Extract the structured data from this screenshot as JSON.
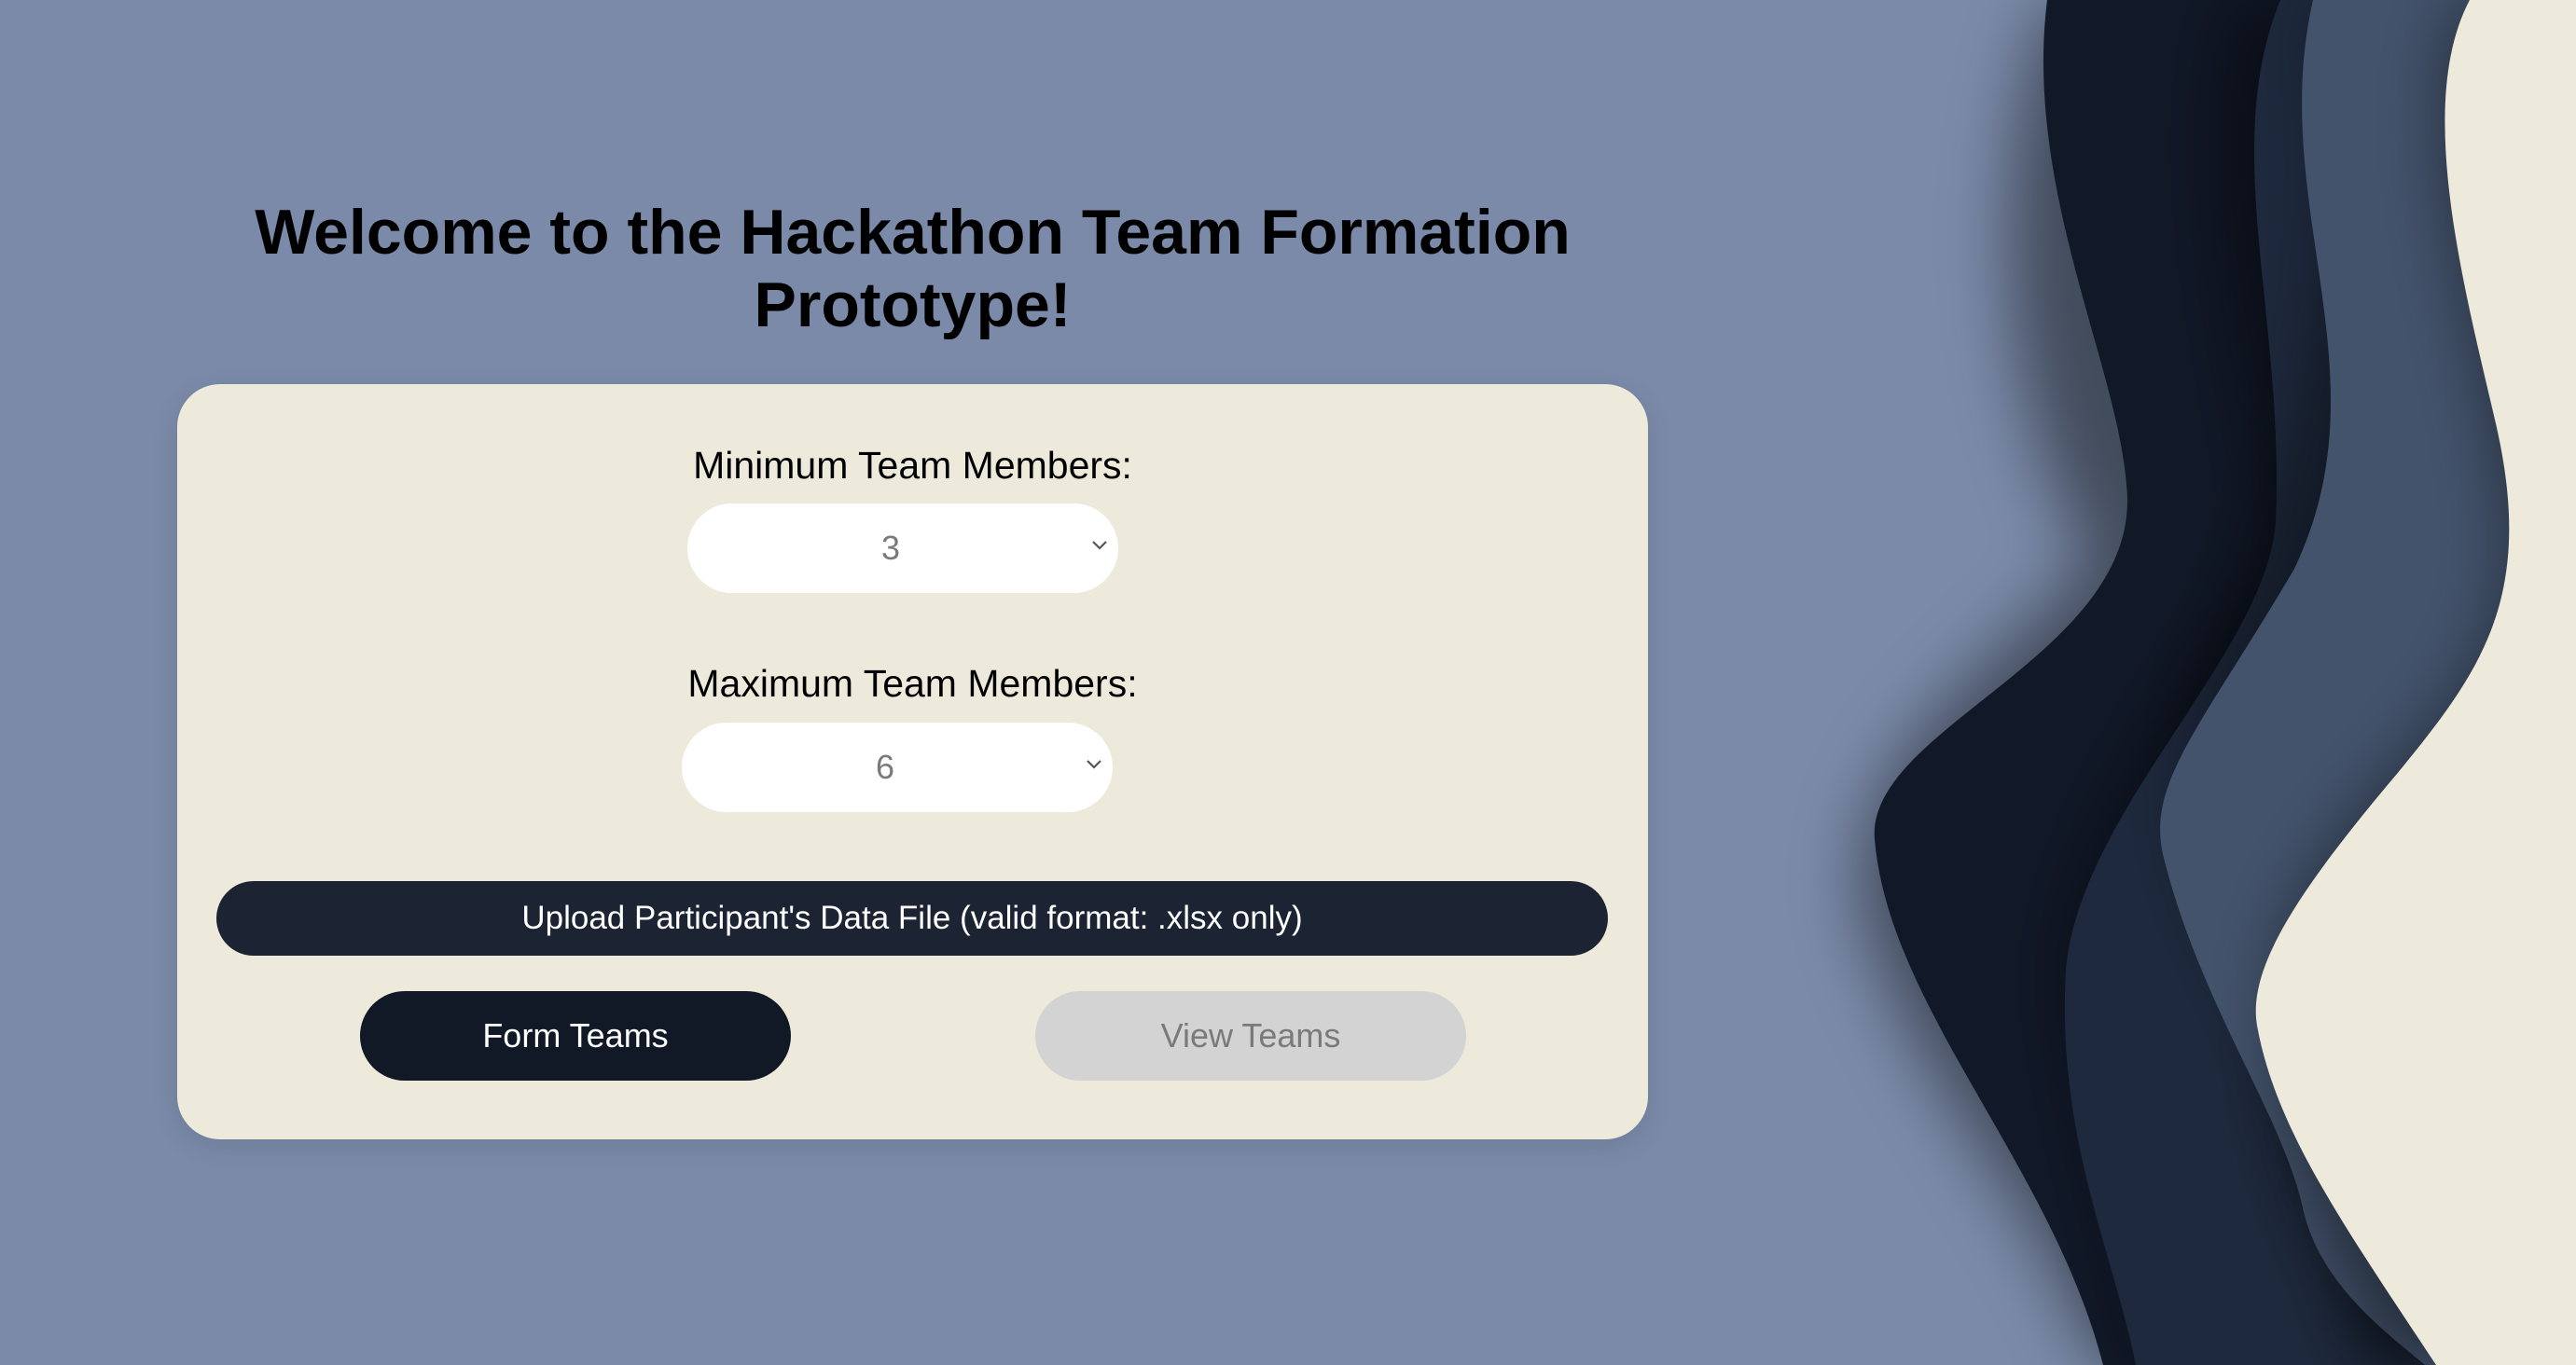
{
  "page": {
    "title": "Welcome to the Hackathon Team Formation Prototype!"
  },
  "form": {
    "min_label": "Minimum Team Members:",
    "min_value": "3",
    "max_label": "Maximum Team Members:",
    "max_value": "6",
    "upload_label": "Upload Participant's Data File (valid format: .xlsx only)",
    "form_button": "Form Teams",
    "view_button": "View Teams"
  },
  "colors": {
    "background": "#7a8aa8",
    "card": "#eeeadb",
    "upload_bar": "#1c2333",
    "primary_button": "#111826",
    "disabled_button": "#d3d3d3"
  }
}
